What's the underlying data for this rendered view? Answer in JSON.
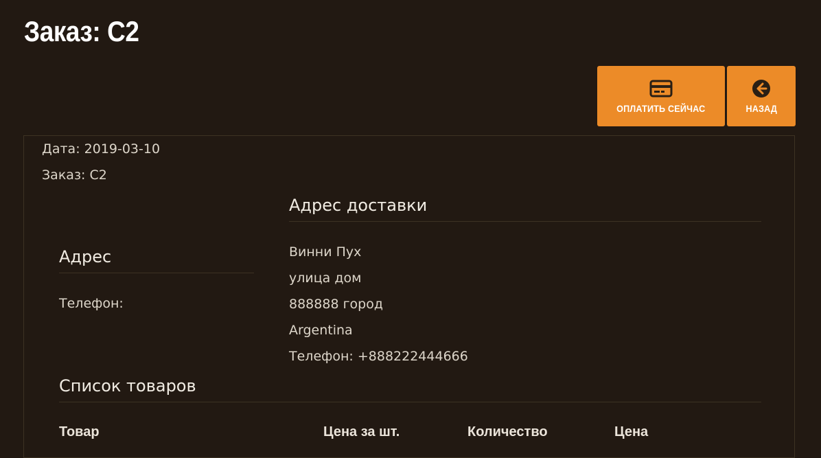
{
  "page": {
    "title": "Заказ: C2"
  },
  "actions": {
    "pay": {
      "label": "ОПЛАТИТЬ СЕЙЧАС",
      "icon": "credit-card-icon"
    },
    "back": {
      "label": "НАЗАД",
      "icon": "arrow-left-circle-icon"
    }
  },
  "order": {
    "date_line": "Дата: 2019-03-10",
    "order_line": "Заказ: C2"
  },
  "address": {
    "title": "Адрес",
    "phone_label": "Телефон:"
  },
  "delivery": {
    "title": "Адрес доставки",
    "lines": [
      "Винни Пух",
      "улица дом",
      "888888 город",
      "Argentina",
      "Телефон: +888222444666"
    ]
  },
  "products": {
    "title": "Список товаров",
    "columns": [
      "Товар",
      "Цена за шт.",
      "Количество",
      "Цена"
    ]
  },
  "colors": {
    "accent": "#ec8b28",
    "background": "#221912",
    "border": "#3d3223"
  }
}
